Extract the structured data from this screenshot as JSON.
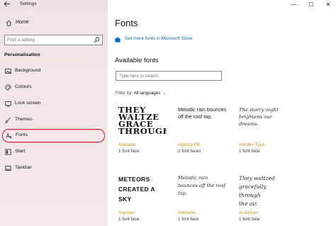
{
  "window": {
    "title": "Settings",
    "controls": [
      "—",
      "☐",
      "✕"
    ]
  },
  "sidebar": {
    "home_label": "Home",
    "search_placeholder": "Find a setting",
    "section_title": "Personalisation",
    "items": [
      {
        "label": "Background",
        "icon": "image-icon"
      },
      {
        "label": "Colours",
        "icon": "palette-icon"
      },
      {
        "label": "Lock screen",
        "icon": "lock-screen-icon"
      },
      {
        "label": "Themes",
        "icon": "brush-icon"
      },
      {
        "label": "Fonts",
        "icon": "font-icon",
        "selected": true
      },
      {
        "label": "Start",
        "icon": "start-icon"
      },
      {
        "label": "Taskbar",
        "icon": "taskbar-icon"
      }
    ]
  },
  "main": {
    "title": "Fonts",
    "store_link": "Get more fonts in Microsoft Store",
    "available_title": "Available fonts",
    "search_placeholder": "Type here to search.",
    "filter_label": "Filter by:",
    "filter_value": "All languages",
    "fonts": [
      {
        "preview": "THEY\nWALTZE\nGRACE\nTHROUGH",
        "name": "Adelaide",
        "faces": "1 font face"
      },
      {
        "preview": "Melodic rain bounces\noff the roof top.",
        "name": "Agency FB",
        "faces": "2 font faces"
      },
      {
        "preview": "The starry night\nbrightens our dreams.",
        "name": "Allinder Type",
        "faces": "1 font face"
      },
      {
        "preview": "METEORS\nCREATED A\nSKY",
        "name": "Algerian",
        "faces": "1 font face"
      },
      {
        "preview": "Melodic rain\nbounces off the roof\ntop.",
        "name": "Alledahe",
        "faces": "1 font face"
      },
      {
        "preview": "They waltzed\ngracefully through\nthe air.",
        "name": "Andaman",
        "faces": "1 font face"
      }
    ]
  },
  "colors": {
    "accent": "#0067b8",
    "font_name": "#d49a00",
    "highlight_circle": "#e0182d"
  }
}
